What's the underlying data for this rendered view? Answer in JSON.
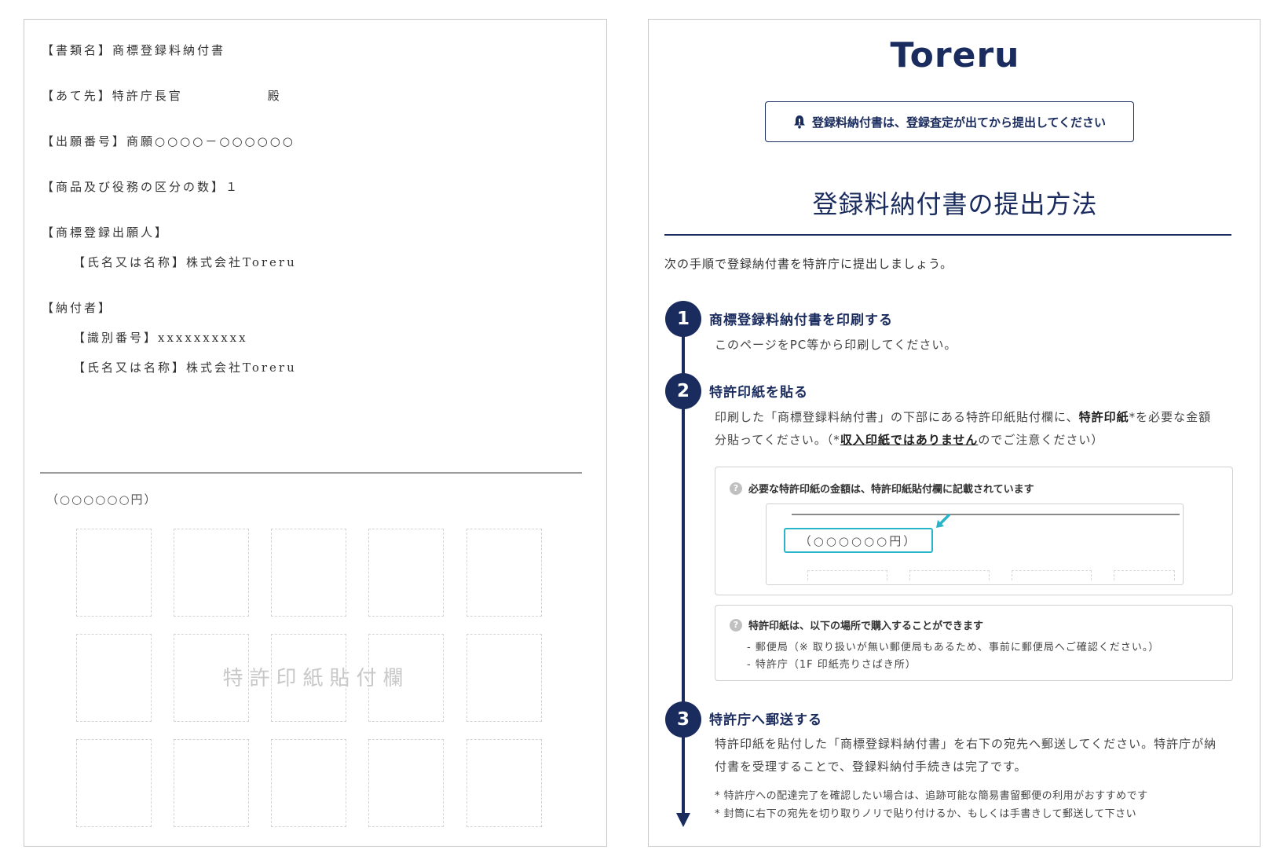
{
  "document": {
    "fields": [
      "【書類名】商標登録料納付書",
      "【あて先】特許庁長官　　　　　　殿",
      "【出願番号】商願○○○○－○○○○○○",
      "【商品及び役務の区分の数】１",
      "【商標登録出願人】",
      "【氏名又は名称】株式会社Toreru",
      "【納付者】",
      "【識別番号】xxxxxxxxxx",
      "【氏名又は名称】株式会社Toreru"
    ],
    "amount": "（○○○○○○円）",
    "stamp_label": "特許印紙貼付欄"
  },
  "guide": {
    "logo": "Toreru",
    "notice": "登録料納付書は、登録査定が出てから提出してください",
    "title": "登録料納付書の提出方法",
    "intro": "次の手順で登録納付書を特許庁に提出しましょう。",
    "steps": [
      {
        "number": "1",
        "title": "商標登録料納付書を印刷する",
        "text": "このページをPC等から印刷してください。"
      },
      {
        "number": "2",
        "title": "特許印紙を貼る",
        "text_a": "印刷した「商標登録料納付書」の下部にある特許印紙貼付欄に、",
        "text_b": "特許印紙",
        "text_c": "*を必要な金額",
        "text_d": "分貼ってください。（*",
        "text_e": "収入印紙ではありません",
        "text_f": "のでご注意ください）"
      },
      {
        "number": "3",
        "title": "特許庁へ郵送する",
        "text_1": "特許印紙を貼付した「商標登録料納付書」を右下の宛先へ郵送してください。特許庁が納",
        "text_2": "付書を受理することで、登録料納付手続きは完了です。",
        "note_1": "* 特許庁への配達完了を確認したい場合は、追跡可能な簡易書留郵便の利用がおすすめです",
        "note_2": "* 封筒に右下の宛先を切り取りノリで貼り付けるか、もしくは手書きして郵送して下さい"
      }
    ],
    "box_amount": {
      "heading": "必要な特許印紙の金額は、特許印紙貼付欄に記載されています",
      "amount": "（○○○○○○円）",
      "icon": "question-icon"
    },
    "box_purchase": {
      "heading": "特許印紙は、以下の場所で購入することができます",
      "items": [
        "- 郵便局（※ 取り扱いが無い郵便局もあるため、事前に郵便局へご確認ください。）",
        "- 特許庁（1F 印紙売りさばき所）"
      ],
      "icon": "question-icon"
    },
    "colors": {
      "navy": "#1a2b5e",
      "accent": "#28b5c9"
    }
  }
}
